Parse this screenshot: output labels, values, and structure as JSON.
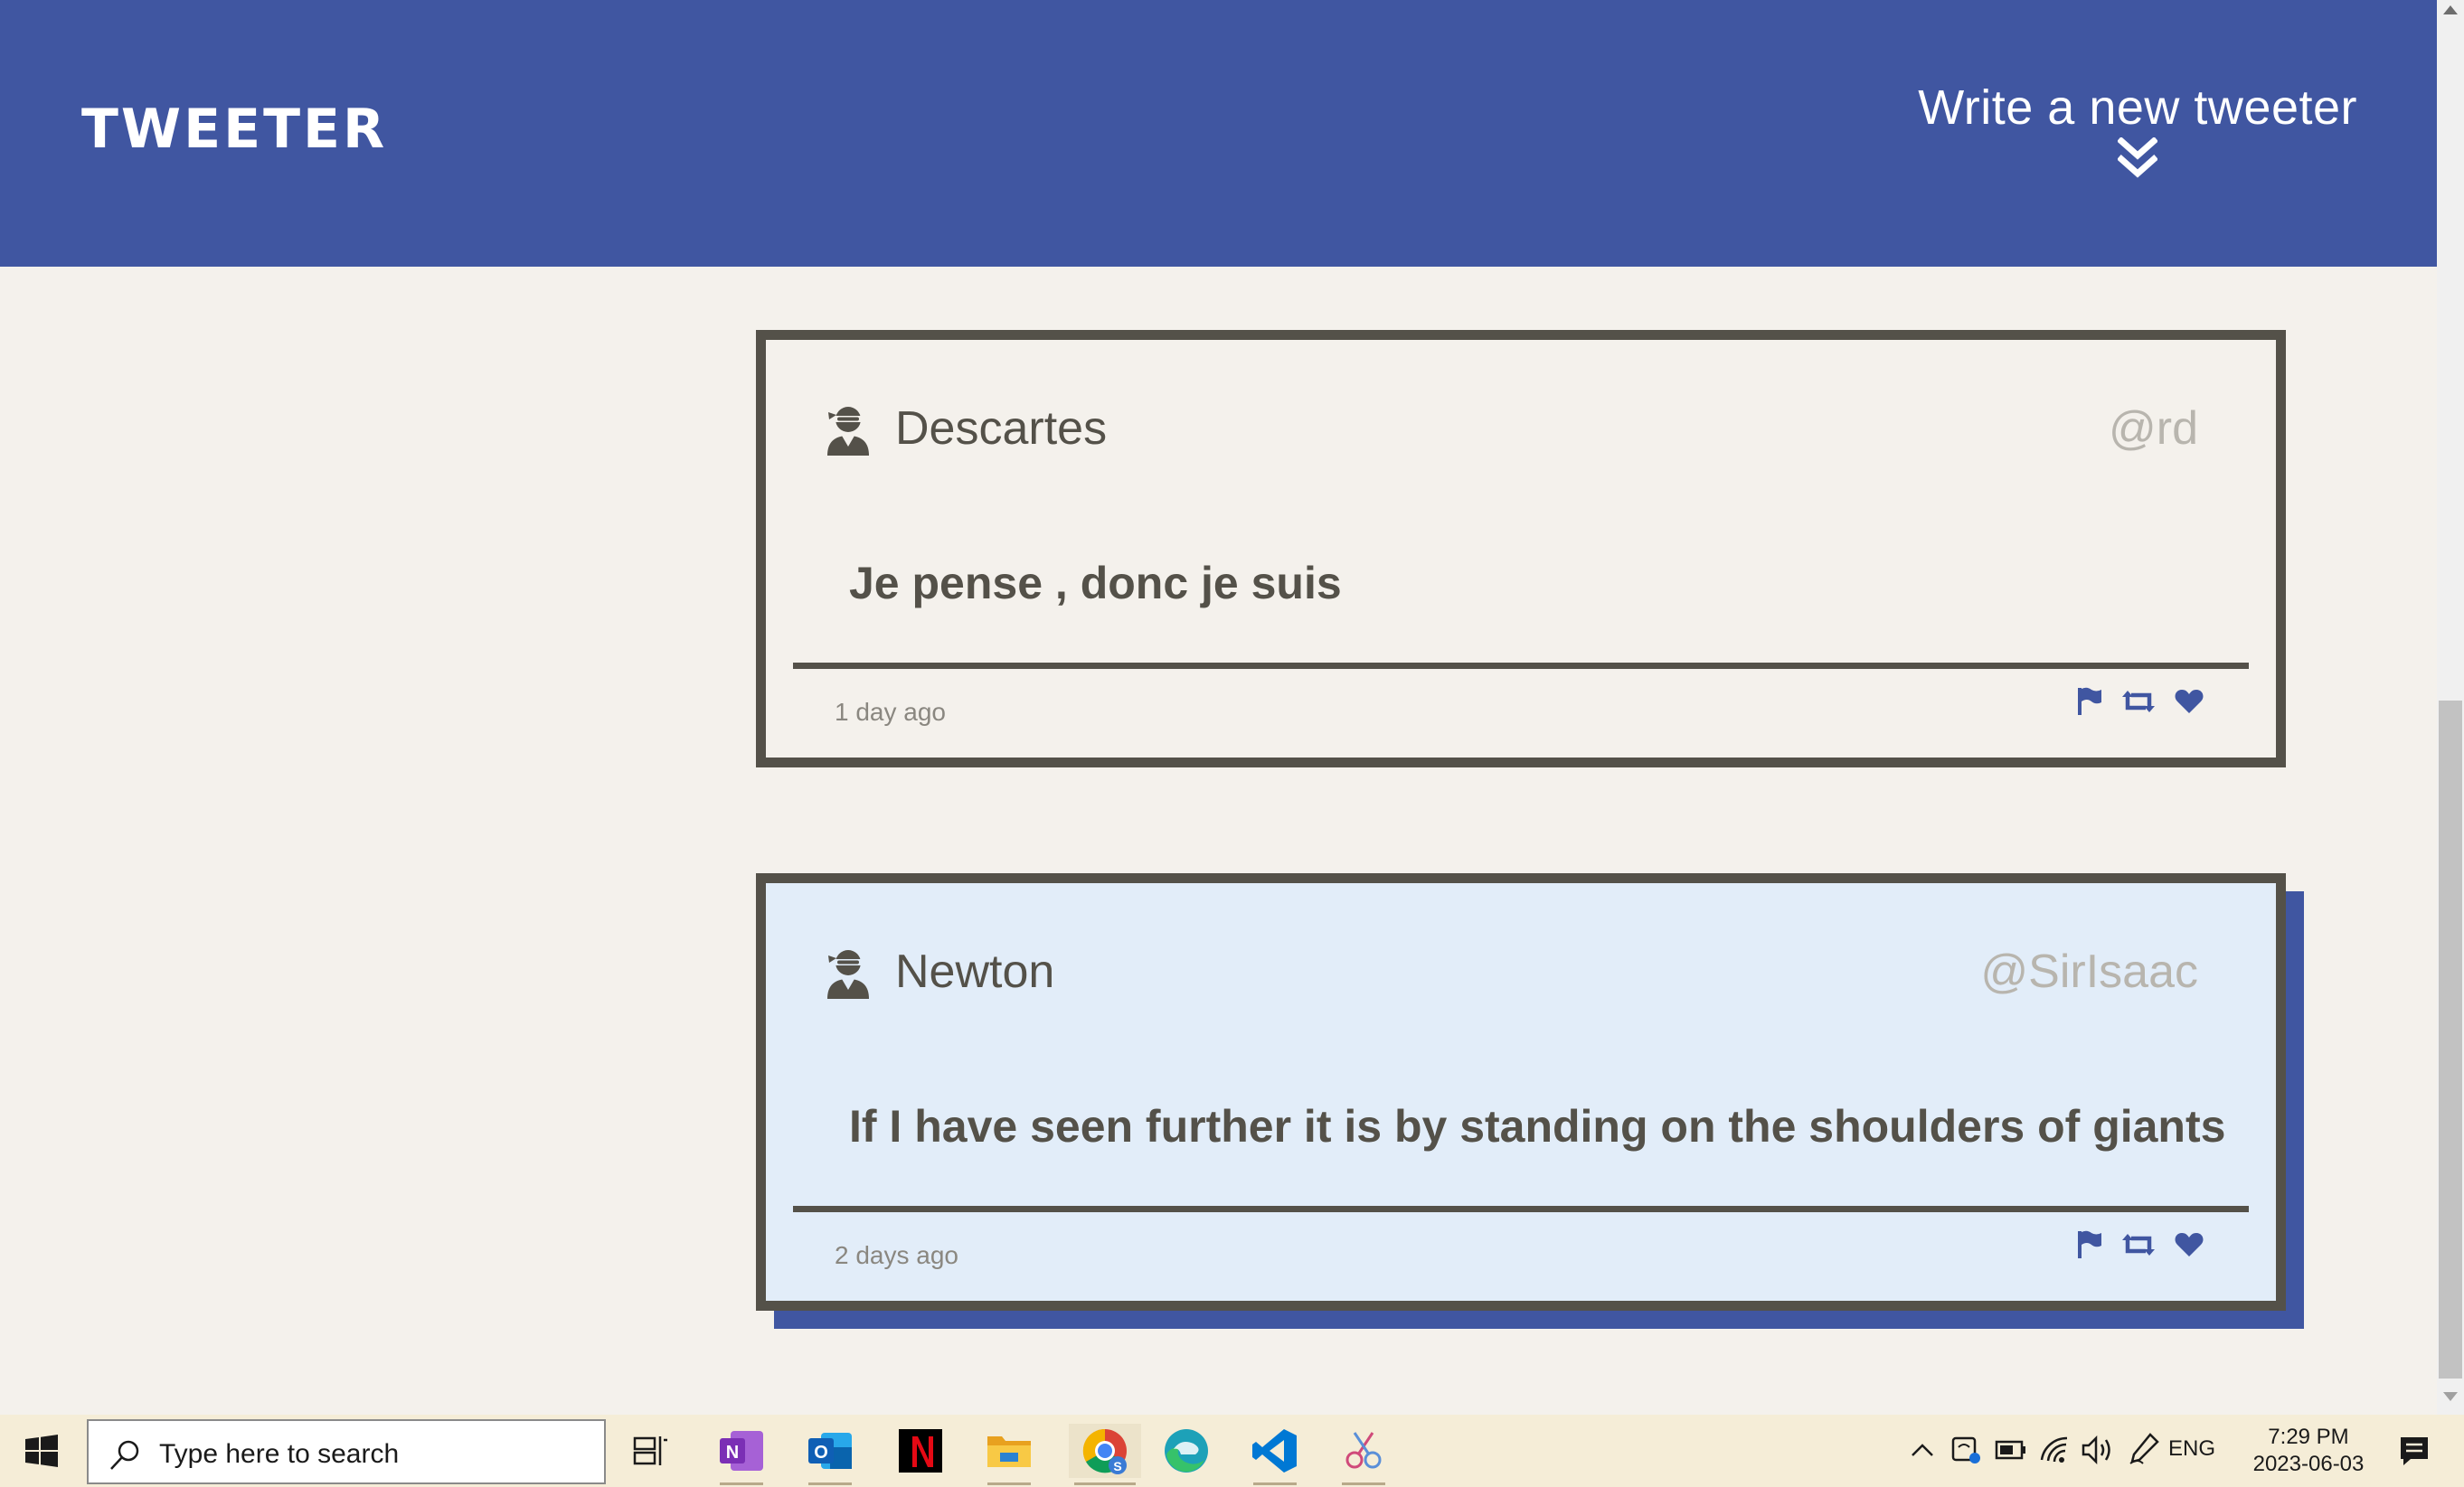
{
  "header": {
    "brand": "TWEETER",
    "compose_label": "Write a new tweeter"
  },
  "tweets": [
    {
      "name": "Descartes",
      "handle": "@rd",
      "text": "Je pense , donc je suis",
      "time": "1 day ago"
    },
    {
      "name": "Newton",
      "handle": "@SirIsaac",
      "text": "If I have seen further it is by standing on the shoulders of giants",
      "time": "2 days ago"
    }
  ],
  "colors": {
    "nav": "#4056a1",
    "text": "#545149",
    "background": "#f4f1ec",
    "hover_background": "#e2edf9",
    "handle": "#b8b5ae"
  },
  "taskbar": {
    "search_placeholder": "Type here to search",
    "apps": [
      "task-view-icon",
      "onenote-icon",
      "outlook-icon",
      "netflix-icon",
      "file-explorer-icon",
      "chrome-icon",
      "edge-icon",
      "vscode-icon",
      "snipping-tool-icon"
    ],
    "language": "ENG",
    "time": "7:29 PM",
    "date": "2023-06-03"
  }
}
